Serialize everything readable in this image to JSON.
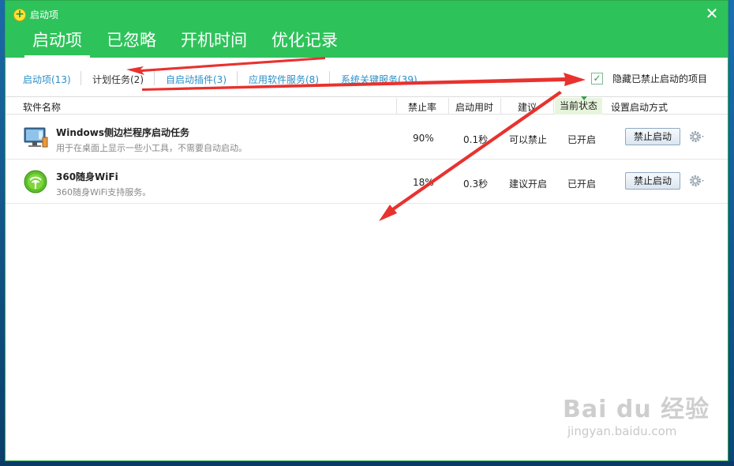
{
  "window": {
    "title": "启动项",
    "close_glyph": "✕"
  },
  "main_tabs": [
    {
      "label": "启动项",
      "active": true
    },
    {
      "label": "已忽略",
      "active": false
    },
    {
      "label": "开机时间",
      "active": false
    },
    {
      "label": "优化记录",
      "active": false
    }
  ],
  "sub_tabs": [
    {
      "label": "启动项(13)"
    },
    {
      "label": "计划任务(2)"
    },
    {
      "label": "自启动插件(3)"
    },
    {
      "label": "应用软件服务(8)"
    },
    {
      "label": "系统关键服务(39)"
    }
  ],
  "hide_disabled": {
    "label": "隐藏已禁止启动的项目",
    "checked": true,
    "check_glyph": "✓"
  },
  "columns": {
    "name": "软件名称",
    "disable_rate": "禁止率",
    "boot_time": "启动用时",
    "suggestion": "建议",
    "status": "当前状态",
    "set_mode": "设置启动方式"
  },
  "rows": [
    {
      "name": "Windows侧边栏程序启动任务",
      "desc": "用于在桌面上显示一些小工具，不需要自动启动。",
      "disable_rate": "90%",
      "boot_time": "0.1秒",
      "suggestion": "可以禁止",
      "status": "已开启",
      "action": "禁止启动",
      "icon": "monitor-icon"
    },
    {
      "name": "360随身WiFi",
      "desc": "360随身WiFi支持服务。",
      "disable_rate": "18%",
      "boot_time": "0.3秒",
      "suggestion": "建议开启",
      "status": "已开启",
      "action": "禁止启动",
      "icon": "wifi-icon"
    }
  ],
  "watermark": {
    "brand": "Bai du 经验",
    "url": "jingyan.baidu.com"
  },
  "colors": {
    "titlebar": "#2ec35a",
    "link": "#2a8fc9",
    "annotation_arrow": "#e8322e"
  }
}
